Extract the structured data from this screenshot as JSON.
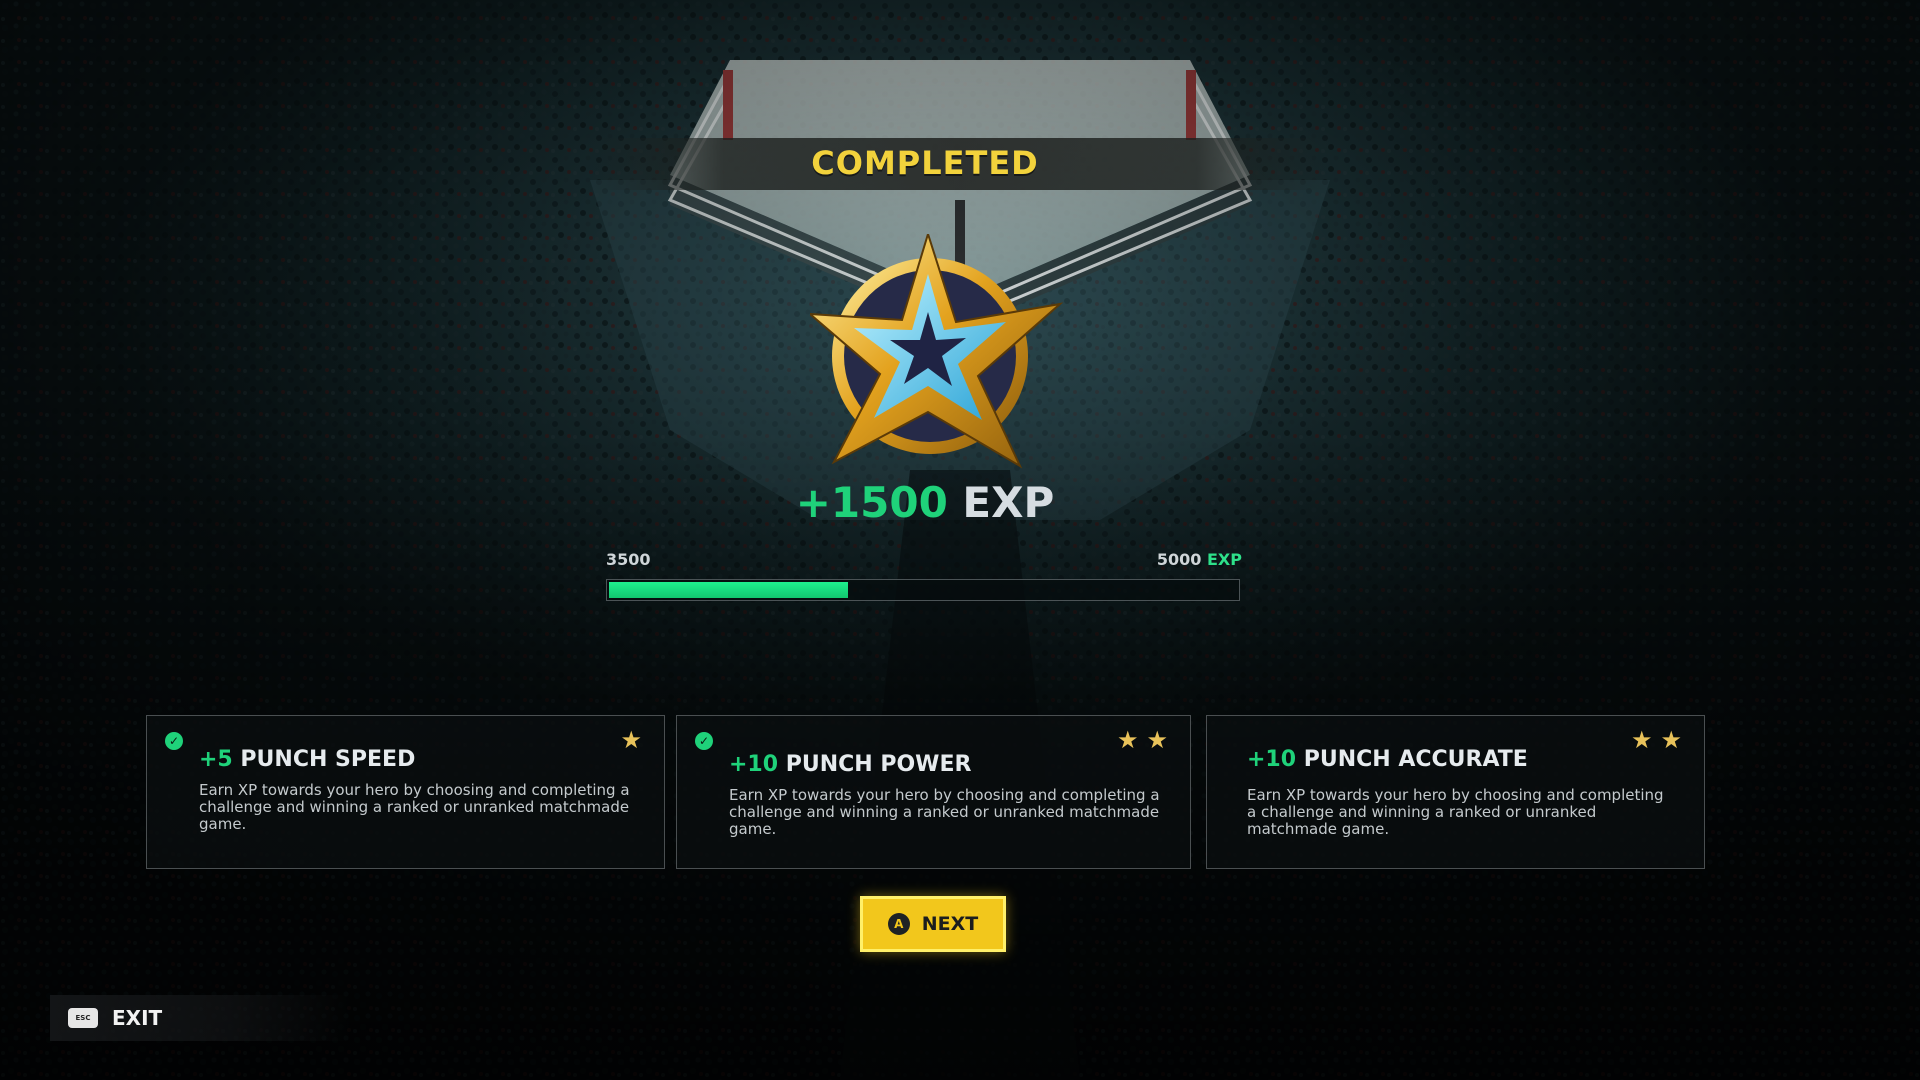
{
  "header": {
    "title": "COMPLETED"
  },
  "reward": {
    "exp_gain": "+1500",
    "exp_unit": "EXP",
    "badge_icon": "star-badge-icon"
  },
  "progress": {
    "min_label": "3500",
    "max_label": "5000",
    "max_unit": "EXP",
    "fill_fraction": 0.38,
    "fill_color": "#1fd27a"
  },
  "cards": [
    {
      "gain": "+5",
      "title": "PUNCH SPEED",
      "description": "Earn XP towards your hero by choosing and completing a challenge and winning a ranked or unranked matchmade game.",
      "stars": "★",
      "completed": true
    },
    {
      "gain": "+10",
      "title": "PUNCH POWER",
      "description": "Earn XP towards your hero by choosing and completing a challenge and winning a ranked or unranked matchmade game.",
      "stars": "★★",
      "completed": true
    },
    {
      "gain": "+10",
      "title": "PUNCH ACCURATE",
      "description": "Earn XP towards your hero by choosing and completing a challenge and winning a ranked or unranked matchmade game.",
      "stars": "★★",
      "completed": false
    }
  ],
  "next_button": {
    "label": "NEXT",
    "key_hint": "A"
  },
  "exit_button": {
    "label": "EXIT",
    "key_hint": "ESC"
  },
  "colors": {
    "accent_yellow": "#f2c71c",
    "accent_green": "#1fd27a",
    "title_yellow": "#f2d23c"
  }
}
